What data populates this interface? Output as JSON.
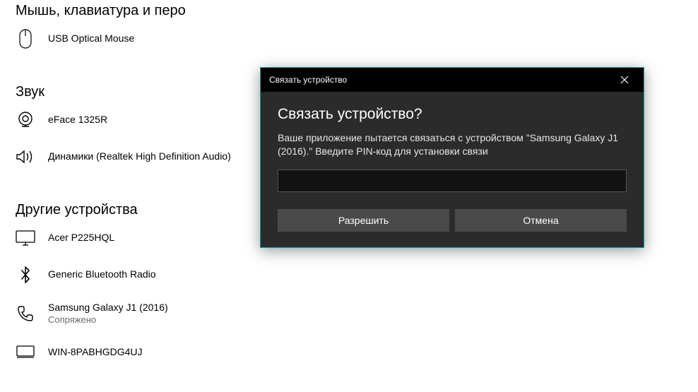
{
  "sections": {
    "mouse_keyboard_pen": {
      "header": "Мышь, клавиатура и перо",
      "devices": [
        {
          "name": "USB Optical Mouse"
        }
      ]
    },
    "sound": {
      "header": "Звук",
      "devices": [
        {
          "name": "eFace 1325R"
        },
        {
          "name": "Динамики (Realtek High Definition Audio)"
        }
      ]
    },
    "other_devices": {
      "header": "Другие устройства",
      "devices": [
        {
          "name": "Acer P225HQL"
        },
        {
          "name": "Generic Bluetooth Radio"
        },
        {
          "name": "Samsung Galaxy J1 (2016)",
          "status": "Сопряжено"
        },
        {
          "name": "WIN-8PABHGDG4UJ"
        }
      ]
    }
  },
  "dialog": {
    "titlebar": "Связать устройство",
    "heading": "Связать устройство?",
    "text": "Ваше приложение пытается связаться с устройством \"Samsung Galaxy J1 (2016).\" Введите PIN-код для установки связи",
    "input_value": "",
    "allow_label": "Разрешить",
    "cancel_label": "Отмена"
  }
}
